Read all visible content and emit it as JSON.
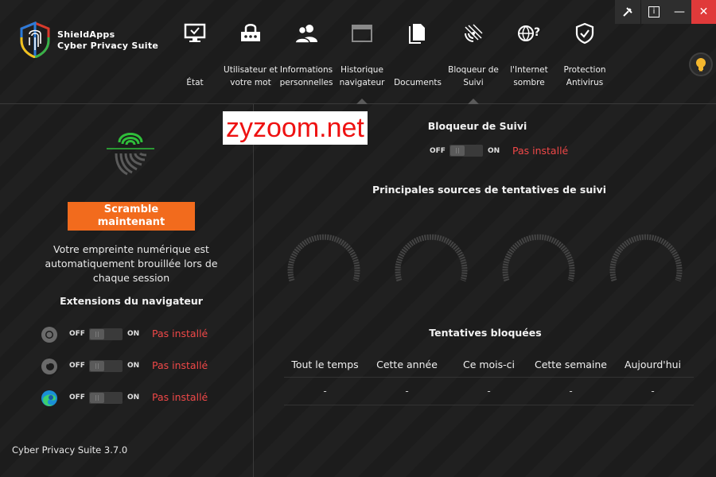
{
  "app": {
    "brand_line1": "ShieldApps",
    "brand_line2": "Cyber Privacy Suite",
    "version": "Cyber Privacy Suite 3.7.0"
  },
  "window_controls": {
    "info_label": "i",
    "minimize_label": "—",
    "close_label": "✕"
  },
  "nav": {
    "items": [
      {
        "label": "État",
        "icon": "monitor-icon"
      },
      {
        "label": "Utilisateur et votre mot",
        "icon": "password-lock-icon"
      },
      {
        "label": "Informations personnelles",
        "icon": "users-icon"
      },
      {
        "label": "Historique navigateur",
        "icon": "browser-window-icon"
      },
      {
        "label": "Documents",
        "icon": "documents-icon"
      },
      {
        "label": "Bloqueur de Suivi",
        "icon": "tracking-radar-icon"
      },
      {
        "label": "l'Internet sombre",
        "icon": "globe-question-icon"
      },
      {
        "label": "Protection Antivirus",
        "icon": "shield-check-icon"
      }
    ],
    "nav_labels": {
      "etat": "État",
      "user_l1": "Utilisateur et",
      "user_l2": "votre mot",
      "info_l1": "Informations",
      "info_l2": "personnelles",
      "hist_l1": "Historique",
      "hist_l2": "navigateur",
      "documents": "Documents",
      "block_l1": "Bloqueur de",
      "block_l2": "Suivi",
      "dark_l1": "l'Internet",
      "dark_l2": "sombre",
      "av_l1": "Protection",
      "av_l2": "Antivirus"
    }
  },
  "left_panel": {
    "scramble_button": "Scramble maintenant",
    "scramble_l1": "Scramble",
    "scramble_l2": "maintenant",
    "description_l1": "Votre empreinte numérique est",
    "description_l2": "automatiquement brouillée lors de",
    "description_l3": "chaque session",
    "extensions_title": "Extensions du navigateur",
    "extensions": [
      {
        "browser_icon": "chrome-icon",
        "off_label": "OFF",
        "on_label": "ON",
        "status": "Pas installé"
      },
      {
        "browser_icon": "firefox-icon",
        "off_label": "OFF",
        "on_label": "ON",
        "status": "Pas installé"
      },
      {
        "browser_icon": "edge-icon",
        "off_label": "OFF",
        "on_label": "ON",
        "status": "Pas installé"
      }
    ]
  },
  "right_panel": {
    "watermark": "zyzoom.net",
    "title": "Bloqueur de Suivi",
    "toggle": {
      "off_label": "OFF",
      "on_label": "ON",
      "status": "Pas installé"
    },
    "sources_title": "Principales sources de tentatives de suivi",
    "blocked_title": "Tentatives bloquées",
    "stats_headers": [
      "Tout le temps",
      "Cette année",
      "Ce mois-ci",
      "Cette semaine",
      "Aujourd'hui"
    ],
    "stats_values": [
      "-",
      "-",
      "-",
      "-",
      "-"
    ]
  },
  "colors": {
    "accent_orange": "#f26b1d",
    "status_red": "#f04848",
    "close_red": "#e03a3a",
    "fingerprint_green": "#2fbf3a"
  }
}
